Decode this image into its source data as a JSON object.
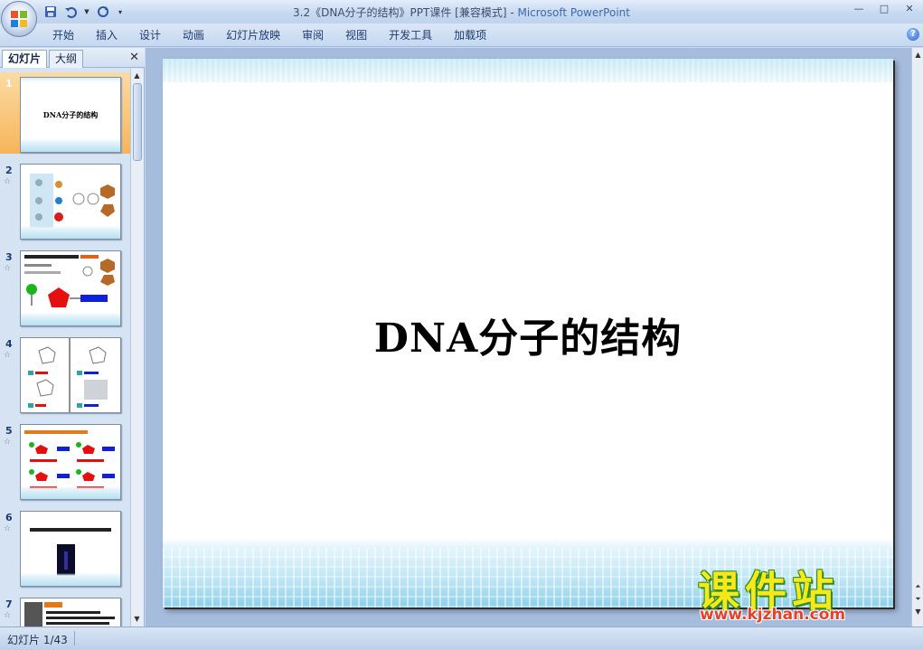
{
  "window": {
    "title": "3.2《DNA分子的结构》PPT课件 [兼容模式] - ",
    "app_name": "Microsoft PowerPoint",
    "controls": {
      "minimize": "—",
      "maximize": "□",
      "close": "✕"
    }
  },
  "ribbon": {
    "tabs": [
      "开始",
      "插入",
      "设计",
      "动画",
      "幻灯片放映",
      "审阅",
      "视图",
      "开发工具",
      "加载项"
    ],
    "help": "?"
  },
  "panel": {
    "tabs": {
      "slides": "幻灯片",
      "outline": "大纲"
    },
    "close": "✕",
    "thumbnails": [
      {
        "num": "1",
        "caption": "DNA分子的结构",
        "selected": true,
        "has_anim": false
      },
      {
        "num": "2",
        "caption": "",
        "selected": false,
        "has_anim": true
      },
      {
        "num": "3",
        "caption": "",
        "selected": false,
        "has_anim": true
      },
      {
        "num": "4",
        "caption": "",
        "selected": false,
        "has_anim": true
      },
      {
        "num": "5",
        "caption": "",
        "selected": false,
        "has_anim": true
      },
      {
        "num": "6",
        "caption": "",
        "selected": false,
        "has_anim": true
      },
      {
        "num": "7",
        "caption": "",
        "selected": false,
        "has_anim": true
      }
    ],
    "anim_marker": "☆"
  },
  "slide": {
    "title": "DNA分子的结构"
  },
  "watermark": {
    "brand": "课件站",
    "url": "www.kjzhan.com"
  },
  "status": {
    "slide_counter": "幻灯片 1/43"
  },
  "colors": {
    "ribbon_bg": "#c5d8f0",
    "selected_thumb": "#f6b55a",
    "watermark_yellow": "#f5e81b",
    "watermark_red": "#e4422a"
  }
}
